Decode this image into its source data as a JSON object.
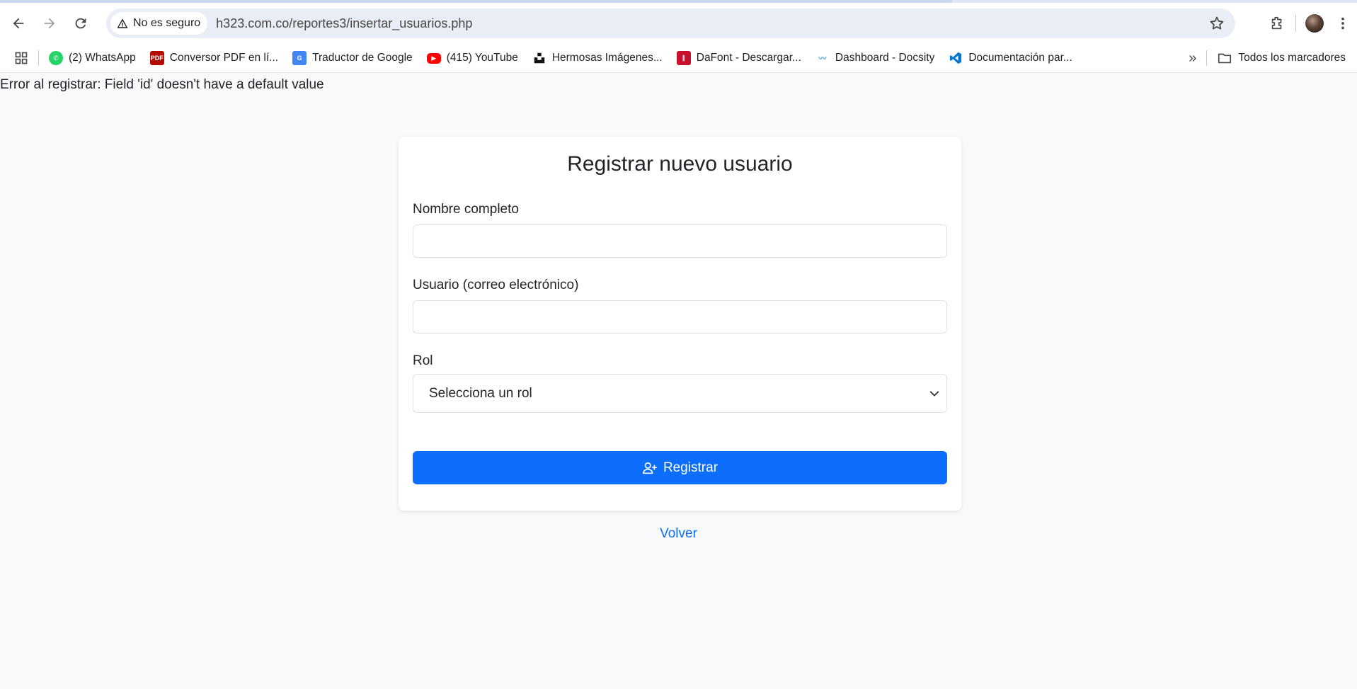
{
  "browser": {
    "security_label": "No es seguro",
    "url": "h323.com.co/reportes3/insertar_usuarios.php",
    "bookmarks": [
      {
        "label": "(2) WhatsApp",
        "icon": "whatsapp-icon",
        "color": "#25d366"
      },
      {
        "label": "Conversor PDF en lí...",
        "icon": "pdf-icon",
        "color": "#b30b00"
      },
      {
        "label": "Traductor de Google",
        "icon": "google-translate-icon",
        "color": "#4285f4"
      },
      {
        "label": "(415) YouTube",
        "icon": "youtube-icon",
        "color": "#ff0000"
      },
      {
        "label": "Hermosas Imágenes...",
        "icon": "unsplash-icon",
        "color": "#111111"
      },
      {
        "label": "DaFont - Descargar...",
        "icon": "dafont-icon",
        "color": "#c8102e"
      },
      {
        "label": "Dashboard - Docsity",
        "icon": "docsity-icon",
        "color": "#4fa3e0"
      },
      {
        "label": "Documentación par...",
        "icon": "vscode-icon",
        "color": "#0078d4"
      }
    ],
    "all_bookmarks_label": "Todos los marcadores"
  },
  "page": {
    "error_message": "Error al registrar: Field 'id' doesn't have a default value",
    "form": {
      "title": "Registrar nuevo usuario",
      "name_label": "Nombre completo",
      "name_value": "",
      "user_label": "Usuario (correo electrónico)",
      "user_value": "",
      "role_label": "Rol",
      "role_selected": "Selecciona un rol",
      "submit_label": "Registrar"
    },
    "back_label": "Volver"
  }
}
